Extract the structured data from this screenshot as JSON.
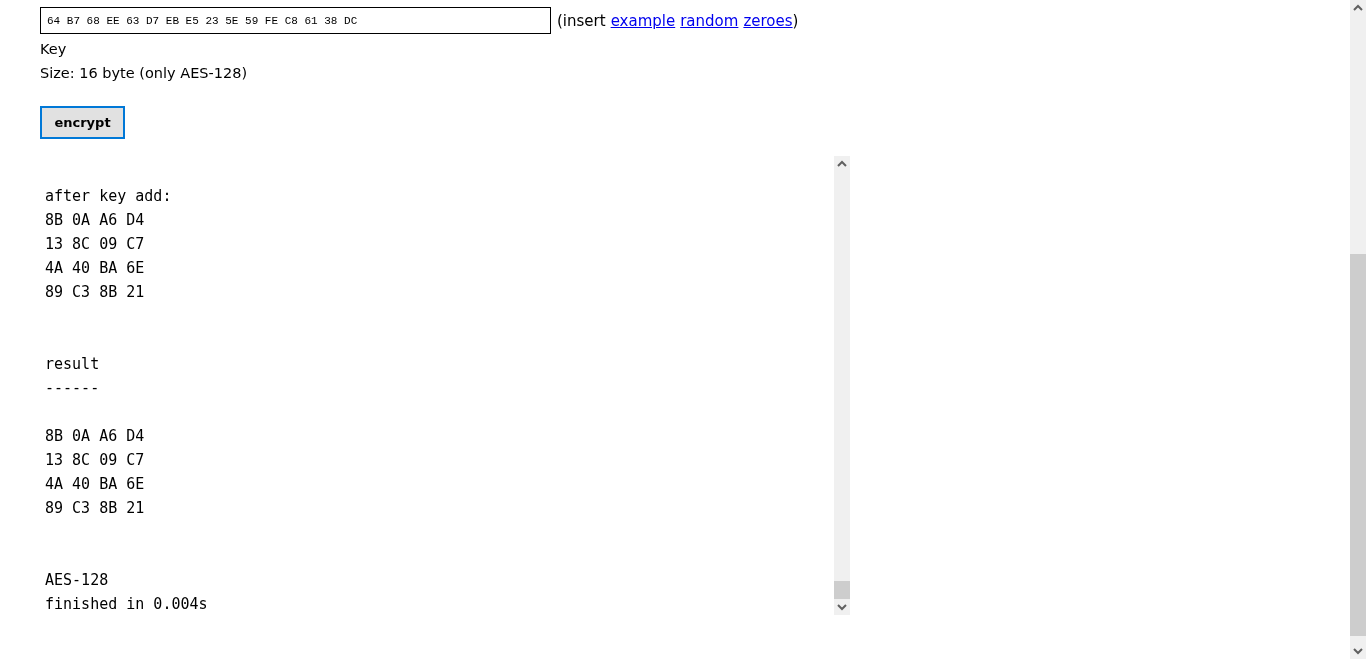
{
  "key_input": {
    "value": "64 B7 68 EE 63 D7 EB E5 23 5E 59 FE C8 61 38 DC"
  },
  "insert": {
    "open": "(insert",
    "links": [
      "example",
      "random",
      "zeroes"
    ],
    "close": ")"
  },
  "key_label": "Key",
  "size_note": "Size: 16 byte (only AES-128)",
  "encrypt_button": "encrypt",
  "output": {
    "blocks": [
      {
        "kind": "section",
        "lines": [
          "after key add:",
          "8B 0A A6 D4",
          "13 8C 09 C7",
          "4A 40 BA 6E",
          "89 C3 8B 21"
        ]
      },
      {
        "kind": "section",
        "lines": [
          "result",
          "------"
        ]
      },
      {
        "kind": "sub",
        "lines": [
          "8B 0A A6 D4",
          "13 8C 09 C7",
          "4A 40 BA 6E",
          "89 C3 8B 21"
        ]
      },
      {
        "kind": "section",
        "lines": [
          "AES-128",
          "finished in 0.004s"
        ]
      }
    ]
  }
}
